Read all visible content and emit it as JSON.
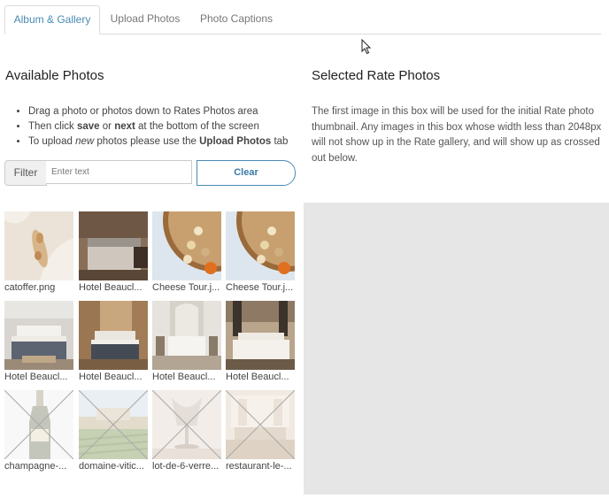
{
  "tabs": [
    {
      "label": "Album & Gallery",
      "active": true
    },
    {
      "label": "Upload Photos",
      "active": false
    },
    {
      "label": "Photo Captions",
      "active": false
    }
  ],
  "available": {
    "title": "Available Photos",
    "instructions": {
      "line1": "Drag a photo or photos down to Rates Photos area",
      "line2_pre": "Then click ",
      "line2_save": "save",
      "line2_mid": " or ",
      "line2_next": "next",
      "line2_post": " at the bottom of the screen",
      "line3_pre": "To upload ",
      "line3_new": "new",
      "line3_mid": " photos please use the ",
      "line3_tab": "Upload Photos",
      "line3_post": " tab"
    },
    "filter": {
      "label": "Filter",
      "placeholder": "Enter text",
      "clear_label": "Clear"
    },
    "photos": [
      {
        "caption": "catoffer.png",
        "crossed": false
      },
      {
        "caption": "Hotel Beaucl...",
        "crossed": false
      },
      {
        "caption": "Cheese Tour.j...",
        "crossed": false
      },
      {
        "caption": "Cheese Tour.j...",
        "crossed": false
      },
      {
        "caption": "Hotel Beaucl...",
        "crossed": false
      },
      {
        "caption": "Hotel Beaucl...",
        "crossed": false
      },
      {
        "caption": "Hotel Beaucl...",
        "crossed": false
      },
      {
        "caption": "Hotel Beaucl...",
        "crossed": false
      },
      {
        "caption": "champagne-...",
        "crossed": true
      },
      {
        "caption": "domaine-vitic...",
        "crossed": true
      },
      {
        "caption": "lot-de-6-verre...",
        "crossed": true
      },
      {
        "caption": "restaurant-le-...",
        "crossed": true
      }
    ]
  },
  "selected": {
    "title": "Selected Rate Photos",
    "description": "The first image in this box will be used for the initial Rate photo thumbnail. Any images in this box whose width less than 2048px will not show up in the Rate gallery, and will show up as crossed out below."
  },
  "colors": {
    "accent": "#4a8bb5",
    "drop_area": "#e6e6e6"
  }
}
